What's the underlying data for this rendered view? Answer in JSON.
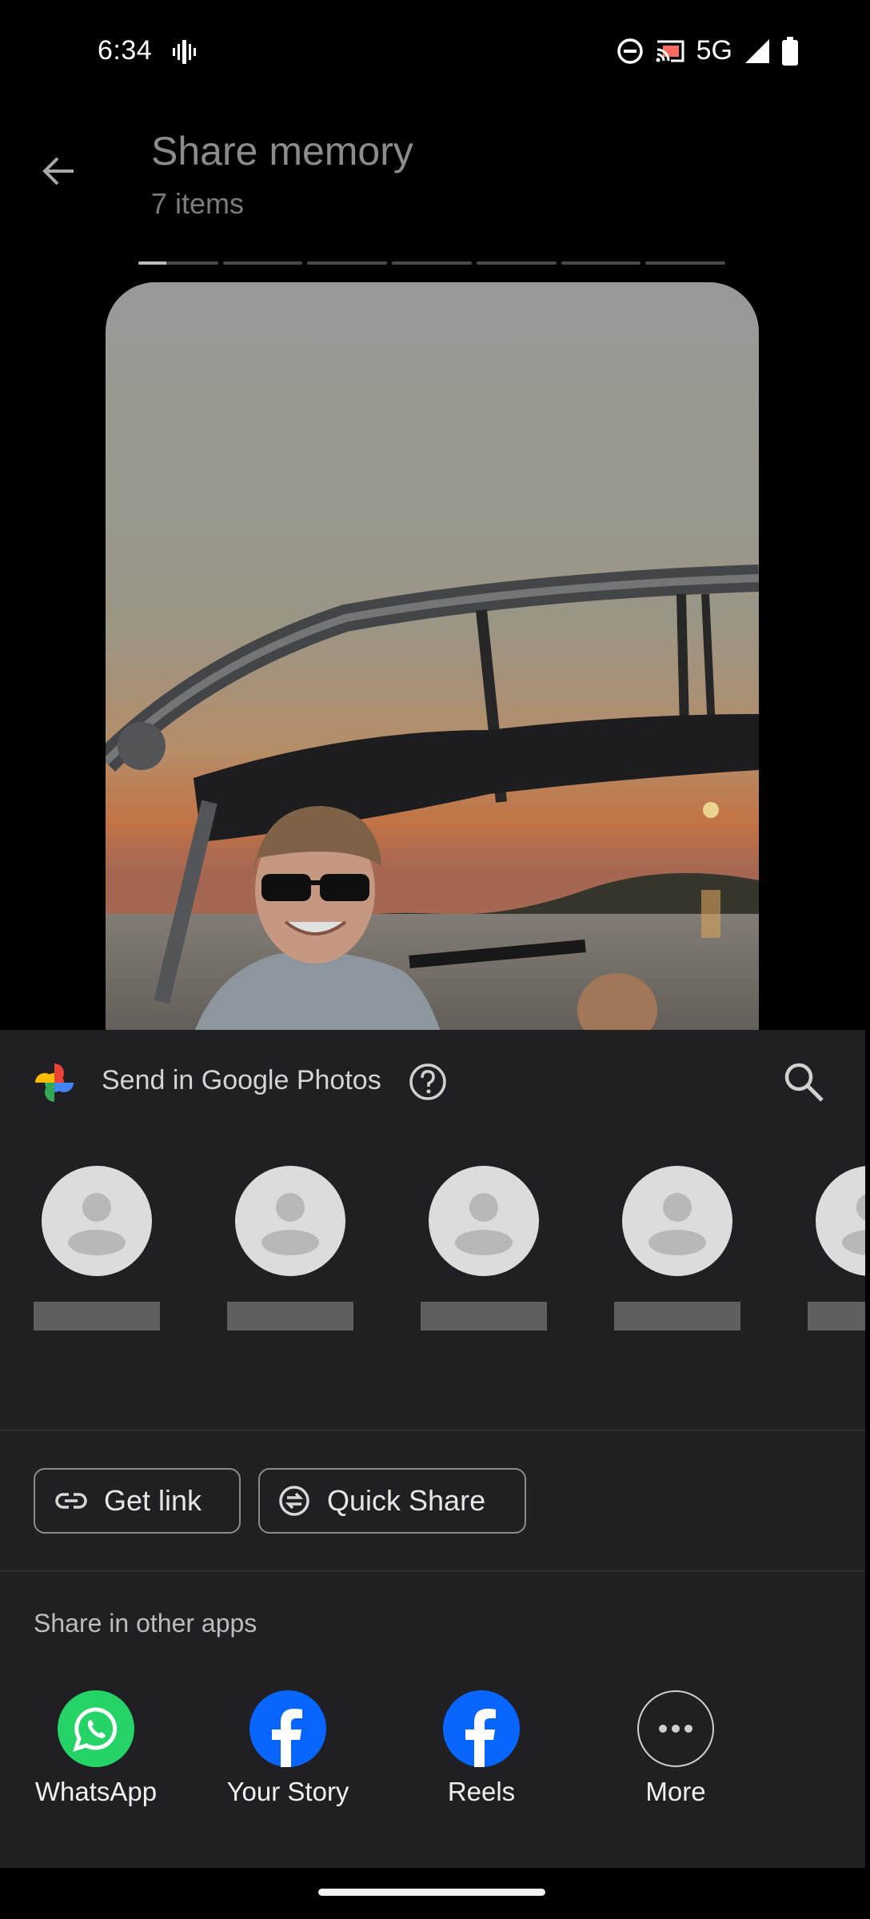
{
  "status_bar": {
    "time": "6:34",
    "network": "5G",
    "icons": [
      "vibrate-icon",
      "do-not-disturb-icon",
      "cast-icon",
      "signal-icon",
      "battery-icon"
    ]
  },
  "header": {
    "back_icon": "arrow-back-icon",
    "title": "Share memory",
    "subtitle": "7 items"
  },
  "progress": {
    "segments": 7,
    "current_index": 0,
    "current_fill_fraction": 0.35
  },
  "photo": {
    "description_icon": "memory-photo"
  },
  "sheet": {
    "send_label": "Send in Google Photos",
    "icons": [
      "google-photos-logo",
      "help-icon",
      "search-icon"
    ],
    "contacts": [
      {
        "avatar": "person-avatar-icon"
      },
      {
        "avatar": "person-avatar-icon"
      },
      {
        "avatar": "person-avatar-icon"
      },
      {
        "avatar": "person-avatar-icon"
      },
      {
        "avatar": "person-avatar-icon"
      }
    ],
    "actions": {
      "get_link": "Get link",
      "quick_share": "Quick Share"
    },
    "other_apps_label": "Share in other apps",
    "apps": [
      {
        "name": "WhatsApp",
        "icon": "whatsapp-icon",
        "color": "#25d366"
      },
      {
        "name": "Your Story",
        "icon": "facebook-icon",
        "color": "#0866ff"
      },
      {
        "name": "Reels",
        "icon": "facebook-icon",
        "color": "#0866ff"
      },
      {
        "name": "More",
        "icon": "more-horiz-icon",
        "color": "#1f1f24"
      }
    ]
  },
  "colors": {
    "background": "#000000",
    "sheet": "#1f1f24",
    "facebook_blue": "#0866ff",
    "whatsapp_green": "#25d366"
  }
}
